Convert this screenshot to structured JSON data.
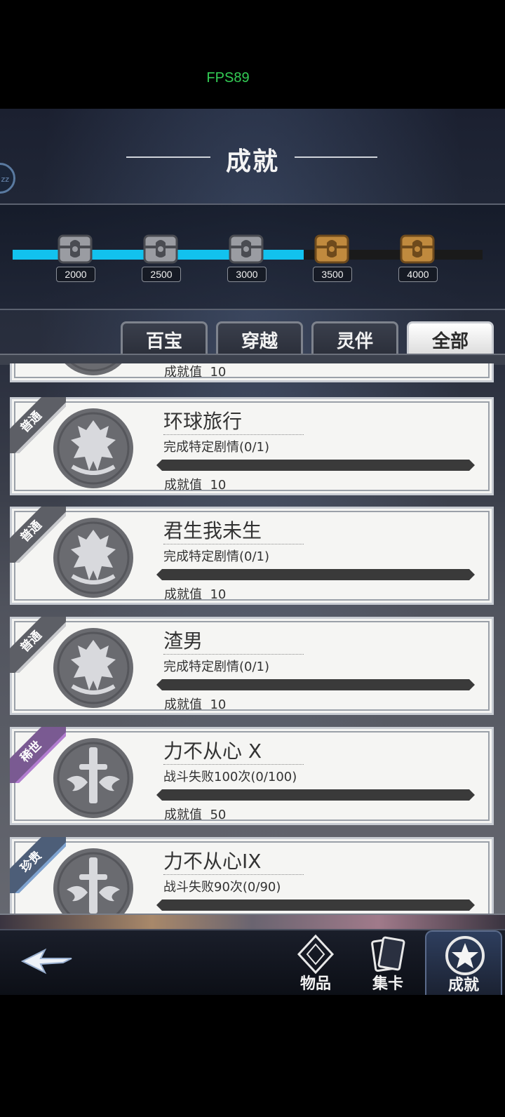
{
  "fps": "FPS89",
  "header": {
    "title": "成就",
    "side_badge": "zz"
  },
  "milestones": {
    "progress_fraction": 0.62,
    "items": [
      {
        "value": "2000",
        "state": "claimed"
      },
      {
        "value": "2500",
        "state": "claimed"
      },
      {
        "value": "3000",
        "state": "claimed"
      },
      {
        "value": "3500",
        "state": "available"
      },
      {
        "value": "4000",
        "state": "available"
      }
    ]
  },
  "tabs": [
    {
      "label": "百宝",
      "active": false
    },
    {
      "label": "穿越",
      "active": false
    },
    {
      "label": "灵伴",
      "active": false
    },
    {
      "label": "全部",
      "active": true
    }
  ],
  "achievements": {
    "points_label": "成就值",
    "items": [
      {
        "rarity": "",
        "name": "",
        "desc": "",
        "points": "10",
        "emblem": "crest-icon"
      },
      {
        "rarity": "普通",
        "name": "环球旅行",
        "desc": "完成特定剧情(0/1)",
        "points": "10",
        "emblem": "crest-icon",
        "progress": 0
      },
      {
        "rarity": "普通",
        "name": "君生我未生",
        "desc": "完成特定剧情(0/1)",
        "points": "10",
        "emblem": "crest-icon",
        "progress": 0
      },
      {
        "rarity": "普通",
        "name": "渣男",
        "desc": "完成特定剧情(0/1)",
        "points": "10",
        "emblem": "crest-icon",
        "progress": 0
      },
      {
        "rarity": "稀世",
        "name": "力不从心 X",
        "desc": "战斗失败100次(0/100)",
        "points": "50",
        "emblem": "sword-icon",
        "progress": 0
      },
      {
        "rarity": "珍贵",
        "name": "力不从心IX",
        "desc": "战斗失败90次(0/90)",
        "points": "",
        "emblem": "sword-icon",
        "progress": 0
      }
    ]
  },
  "nav": {
    "back_icon": "back-arrow-icon",
    "items": [
      {
        "label": "物品",
        "icon": "diamond-icon",
        "active": false
      },
      {
        "label": "集卡",
        "icon": "cards-icon",
        "active": false
      },
      {
        "label": "成就",
        "icon": "star-medal-icon",
        "active": true
      }
    ]
  }
}
